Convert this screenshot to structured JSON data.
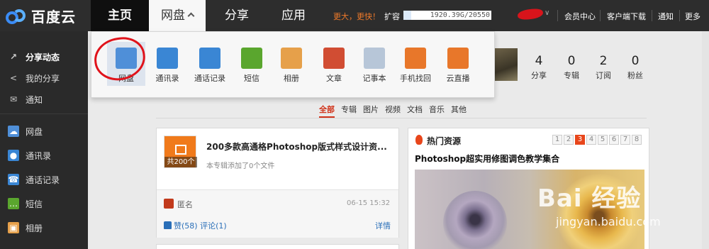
{
  "logo": {
    "text": "百度云"
  },
  "nav": {
    "home": "主页",
    "pan": "网盘",
    "share": "分享",
    "app": "应用"
  },
  "topbar": {
    "promo": "更大，更快！",
    "expand": "扩容",
    "quota": "1920.39G/20550",
    "links": [
      "会员中心",
      "客户端下载",
      "通知",
      "更多"
    ]
  },
  "sidebar": {
    "items": [
      {
        "label": "分享动态",
        "icon": "activity-icon",
        "active": true
      },
      {
        "label": "我的分享",
        "icon": "share-icon",
        "active": false
      },
      {
        "label": "通知",
        "icon": "mail-icon",
        "active": false
      },
      {
        "label": "网盘",
        "icon": "cloud-icon",
        "active": false
      },
      {
        "label": "通讯录",
        "icon": "contacts-icon",
        "active": false
      },
      {
        "label": "通话记录",
        "icon": "call-log-icon",
        "active": false
      },
      {
        "label": "短信",
        "icon": "sms-icon",
        "active": false
      },
      {
        "label": "相册",
        "icon": "album-icon",
        "active": false
      }
    ]
  },
  "dropdown": {
    "items": [
      {
        "label": "网盘",
        "icon": "cloud-drive-icon",
        "color": "#4f8fd8"
      },
      {
        "label": "通讯录",
        "icon": "contacts-icon",
        "color": "#3a86d4"
      },
      {
        "label": "通话记录",
        "icon": "call-log-icon",
        "color": "#3a86d4"
      },
      {
        "label": "短信",
        "icon": "sms-icon",
        "color": "#5aa62e"
      },
      {
        "label": "相册",
        "icon": "album-icon",
        "color": "#e6a04a"
      },
      {
        "label": "文章",
        "icon": "article-icon",
        "color": "#d14d33"
      },
      {
        "label": "记事本",
        "icon": "notepad-icon",
        "color": "#b7c6d8"
      },
      {
        "label": "手机找回",
        "icon": "phone-find-icon",
        "color": "#e8772a"
      },
      {
        "label": "云直播",
        "icon": "cloud-live-icon",
        "color": "#e8772a"
      }
    ]
  },
  "profile": {
    "stats": [
      {
        "num": "4",
        "label": "分享"
      },
      {
        "num": "0",
        "label": "专辑"
      },
      {
        "num": "2",
        "label": "订阅"
      },
      {
        "num": "0",
        "label": "粉丝"
      }
    ]
  },
  "filters": [
    "全部",
    "专辑",
    "图片",
    "视频",
    "文档",
    "音乐",
    "其他"
  ],
  "feed": {
    "title": "200多款高通格Photoshop版式样式设计资...",
    "count_badge": "共200个",
    "subtitle": "本专辑添加了0个文件",
    "author": "匿名",
    "time": "06-15 15:32",
    "like": "赞(58)",
    "comment": "评论(1)",
    "detail": "详情"
  },
  "hot": {
    "title": "热门资源",
    "pages": [
      "1",
      "2",
      "3",
      "4",
      "5",
      "6",
      "7",
      "8"
    ],
    "current_page": "3",
    "resource_title": "Photoshop超实用修图调色教学集合"
  },
  "watermark": {
    "brand": "Bai 经验",
    "url": "jingyan.baidu.com"
  },
  "colors": {
    "accent": "#d0331a",
    "link": "#2a6fb8",
    "topbar": "#2d2d2d",
    "sidebar": "#2a2a2a"
  }
}
